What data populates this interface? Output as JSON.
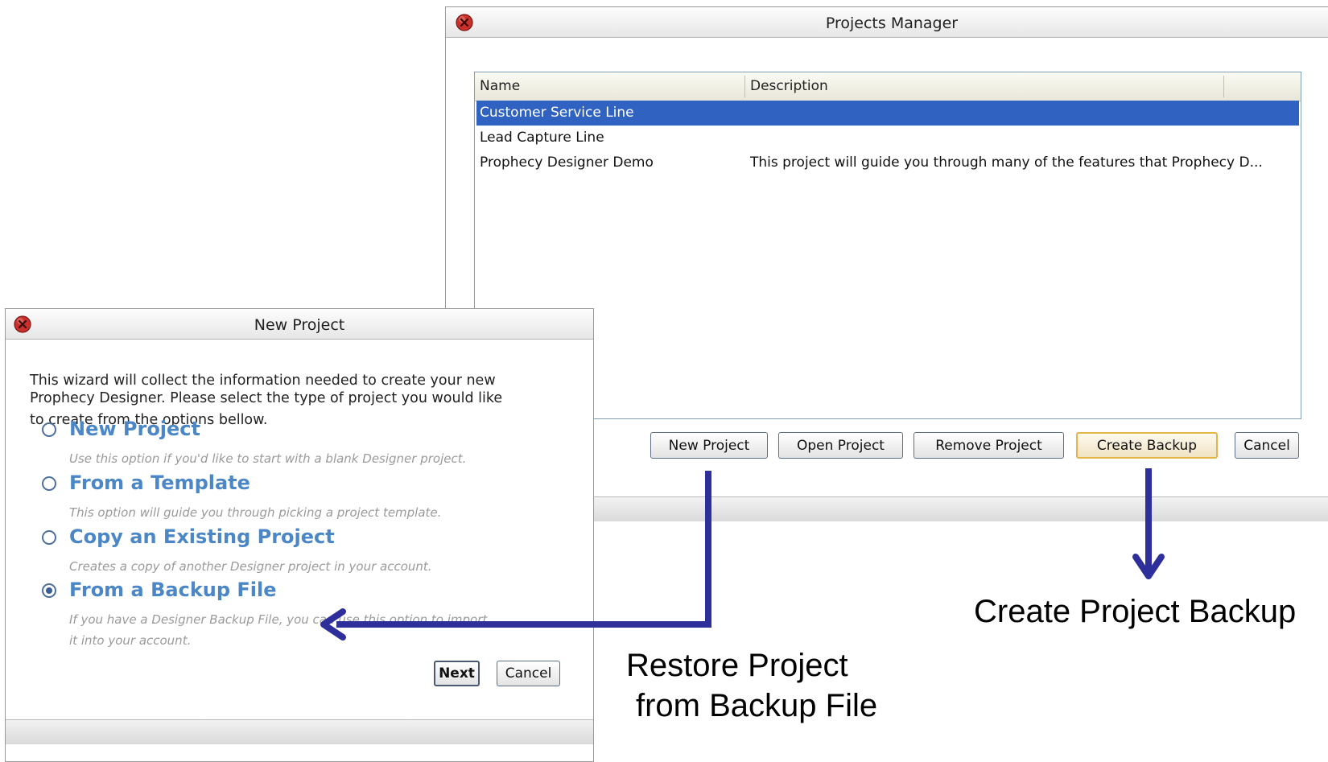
{
  "projects_manager": {
    "title": "Projects Manager",
    "columns": [
      "Name",
      "Description"
    ],
    "rows": [
      {
        "name": "Customer Service Line",
        "description": "",
        "selected": true
      },
      {
        "name": "Lead Capture Line",
        "description": "",
        "selected": false
      },
      {
        "name": "Prophecy Designer Demo",
        "description": "This project will guide you through many of the features that Prophecy D...",
        "selected": false
      }
    ],
    "buttons": {
      "new_project": "New Project",
      "open_project": "Open Project",
      "remove_project": "Remove Project",
      "create_backup": "Create Backup",
      "cancel": "Cancel"
    }
  },
  "new_project": {
    "title": "New Project",
    "intro_line1": "This wizard will collect the information needed to create your new",
    "intro_line2": "Prophecy Designer. Please select the type of project you would like",
    "intro_line3": "to create from the options bellow.",
    "options": [
      {
        "title": "New Project",
        "desc1": "Use this option if you'd like to start with a blank Designer project.",
        "desc2": "",
        "checked": false
      },
      {
        "title": "From a Template",
        "desc1": "This option will guide you through picking a project template.",
        "desc2": "",
        "checked": false
      },
      {
        "title": "Copy an Existing Project",
        "desc1": "Creates a copy of another Designer project in your account.",
        "desc2": "",
        "checked": false
      },
      {
        "title": "From a Backup File",
        "desc1": "If you have a Designer Backup File, you can use this option to import",
        "desc2": "it into your account.",
        "checked": true
      }
    ],
    "buttons": {
      "next": "Next",
      "cancel": "Cancel"
    }
  },
  "annotations": {
    "create_backup": "Create Project Backup",
    "restore_line1": "Restore Project",
    "restore_line2": "from Backup File"
  },
  "colors": {
    "selection": "#2f62c1",
    "option_title": "#4b87c7",
    "arrow": "#2e2f9b",
    "default_button_border": "#e3b64a"
  }
}
